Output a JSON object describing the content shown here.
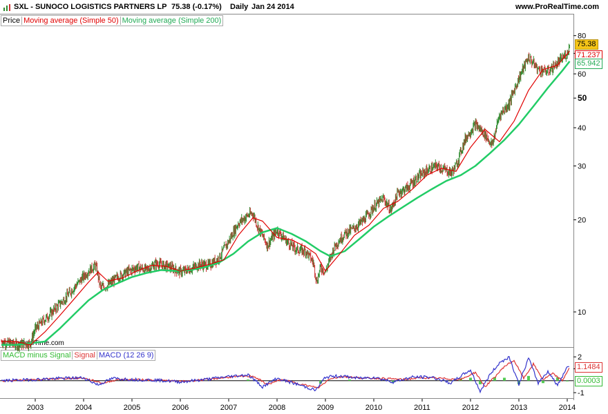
{
  "header": {
    "symbol_title": "SXL - SUNOCO LOGISTICS PARTNERS LP",
    "last_quote": "75.38 (-0.17%)",
    "interval": "Daily",
    "date": "Jan 24 2014",
    "website": "www.ProRealTime.com"
  },
  "main_legend": {
    "price": "Price",
    "ma50": "Moving average (Simple 50)",
    "ma200": "Moving average (Simple 200)"
  },
  "macd_legend": {
    "hist": "MACD minus Signal",
    "signal": "Signal",
    "macd": "MACD (12 26 9)"
  },
  "copyright": "© ProRealTime.com",
  "tags": {
    "price": "75.38",
    "ma50": "71.237",
    "ma200": "65.942",
    "signal": "1.1484",
    "hist": "0.0003"
  },
  "colors": {
    "up": "#2e8b2e",
    "down": "#cc3333",
    "ma50": "#e00000",
    "ma200": "#22cc66",
    "macd": "#3333cc",
    "signal": "#dd3333",
    "hist": "#55cc55",
    "price_tag_bg": "#f5c518"
  },
  "chart_data": [
    {
      "type": "line",
      "scale": "log",
      "ylim": [
        8,
        85
      ],
      "y_ticks": [
        80,
        70,
        60,
        50,
        40,
        30,
        20,
        10
      ],
      "x_ticks": [
        "2003",
        "2004",
        "2005",
        "2006",
        "2007",
        "2008",
        "2009",
        "2010",
        "2011",
        "2012",
        "2013",
        "2014"
      ],
      "x_range": [
        2002.3,
        2014.1
      ],
      "series": [
        {
          "name": "Price",
          "x": [
            2002.3,
            2002.6,
            2002.9,
            2003.0,
            2003.3,
            2003.6,
            2003.9,
            2004.1,
            2004.25,
            2004.35,
            2004.5,
            2004.7,
            2004.9,
            2005.1,
            2005.3,
            2005.5,
            2005.8,
            2006.0,
            2006.2,
            2006.4,
            2006.6,
            2006.8,
            2007.0,
            2007.2,
            2007.4,
            2007.5,
            2007.6,
            2007.8,
            2008.0,
            2008.2,
            2008.4,
            2008.6,
            2008.75,
            2008.82,
            2008.9,
            2009.0,
            2009.2,
            2009.4,
            2009.6,
            2009.8,
            2010.0,
            2010.2,
            2010.35,
            2010.5,
            2010.7,
            2010.9,
            2011.1,
            2011.3,
            2011.5,
            2011.6,
            2011.7,
            2011.9,
            2012.1,
            2012.3,
            2012.45,
            2012.6,
            2012.8,
            2013.0,
            2013.2,
            2013.4,
            2013.6,
            2013.8,
            2014.0,
            2014.05
          ],
          "values": [
            8.0,
            7.8,
            7.9,
            8.8,
            9.8,
            11.0,
            12.5,
            13.6,
            14.2,
            12.0,
            12.2,
            13.0,
            13.5,
            14.0,
            13.7,
            14.4,
            14.0,
            13.5,
            13.8,
            14.3,
            14.2,
            15.0,
            17.0,
            19.5,
            20.7,
            21.0,
            19.0,
            16.5,
            18.5,
            17.0,
            16.0,
            15.8,
            14.5,
            12.5,
            14.0,
            13.5,
            16.5,
            18.0,
            18.8,
            20.0,
            22.0,
            23.5,
            21.5,
            24.5,
            25.5,
            27.5,
            29.0,
            30.0,
            29.0,
            28.5,
            30.0,
            37.0,
            41.0,
            38.0,
            35.0,
            44.0,
            48.0,
            58.0,
            68.0,
            62.0,
            61.0,
            65.0,
            70.0,
            75.38
          ]
        },
        {
          "name": "Moving average (Simple 50)",
          "x": [
            2002.3,
            2002.6,
            2002.9,
            2003.2,
            2003.5,
            2003.8,
            2004.1,
            2004.3,
            2004.5,
            2004.8,
            2005.1,
            2005.4,
            2005.7,
            2006.0,
            2006.3,
            2006.6,
            2006.9,
            2007.2,
            2007.5,
            2007.7,
            2008.0,
            2008.3,
            2008.6,
            2008.8,
            2009.0,
            2009.3,
            2009.6,
            2009.9,
            2010.2,
            2010.5,
            2010.8,
            2011.1,
            2011.4,
            2011.7,
            2012.0,
            2012.3,
            2012.6,
            2012.9,
            2013.2,
            2013.5,
            2013.8,
            2014.05
          ],
          "values": [
            8.0,
            8.0,
            7.8,
            8.6,
            9.7,
            11.0,
            12.5,
            13.5,
            12.6,
            12.9,
            13.6,
            14.2,
            14.1,
            13.6,
            13.9,
            14.3,
            14.8,
            17.8,
            20.3,
            19.8,
            17.5,
            17.2,
            16.3,
            15.5,
            13.6,
            15.5,
            17.8,
            19.2,
            21.8,
            23.0,
            25.2,
            28.0,
            29.5,
            28.8,
            34.5,
            39.5,
            36.0,
            42.0,
            53.0,
            62.0,
            64.0,
            71.237
          ]
        },
        {
          "name": "Moving average (Simple 200)",
          "x": [
            2002.3,
            2002.6,
            2002.9,
            2003.2,
            2003.5,
            2003.8,
            2004.1,
            2004.4,
            2004.7,
            2005.0,
            2005.3,
            2005.6,
            2005.9,
            2006.2,
            2006.5,
            2006.8,
            2007.1,
            2007.4,
            2007.7,
            2008.0,
            2008.3,
            2008.6,
            2008.9,
            2009.1,
            2009.4,
            2009.7,
            2010.0,
            2010.3,
            2010.6,
            2010.9,
            2011.2,
            2011.5,
            2011.8,
            2012.1,
            2012.4,
            2012.7,
            2013.0,
            2013.3,
            2013.6,
            2013.9,
            2014.05
          ],
          "values": [
            7.8,
            7.8,
            7.9,
            8.0,
            8.8,
            9.8,
            10.9,
            11.8,
            12.4,
            13.0,
            13.4,
            13.7,
            13.6,
            13.7,
            14.0,
            14.5,
            15.5,
            17.0,
            18.2,
            18.8,
            18.0,
            17.0,
            15.8,
            15.2,
            15.8,
            17.3,
            19.0,
            20.5,
            22.0,
            23.6,
            25.2,
            26.8,
            28.0,
            30.0,
            33.0,
            36.5,
            41.0,
            47.0,
            54.0,
            61.5,
            65.942
          ]
        }
      ]
    },
    {
      "type": "line",
      "ylim": [
        -1.4,
        2.3
      ],
      "y_ticks": [
        2,
        1,
        -1
      ],
      "series": [
        {
          "name": "MACD (12 26 9)",
          "x": [
            2002.3,
            2003.0,
            2003.5,
            2004.0,
            2004.3,
            2004.6,
            2005.0,
            2005.5,
            2006.0,
            2006.5,
            2007.0,
            2007.4,
            2007.7,
            2008.0,
            2008.5,
            2008.8,
            2009.0,
            2009.3,
            2009.7,
            2010.0,
            2010.4,
            2010.8,
            2011.2,
            2011.6,
            2011.8,
            2012.0,
            2012.2,
            2012.4,
            2012.6,
            2012.8,
            2013.0,
            2013.2,
            2013.4,
            2013.6,
            2013.8,
            2014.0,
            2014.05
          ],
          "values": [
            0.0,
            0.1,
            0.2,
            0.25,
            -0.35,
            0.2,
            0.1,
            0.05,
            -0.1,
            0.1,
            0.35,
            0.5,
            -0.5,
            0.2,
            -0.4,
            -0.8,
            0.3,
            0.4,
            0.2,
            0.3,
            -0.1,
            0.3,
            0.3,
            -0.2,
            0.4,
            0.9,
            -0.9,
            0.5,
            1.5,
            2.0,
            -0.3,
            1.9,
            -0.2,
            0.8,
            -0.4,
            1.2,
            1.15
          ]
        },
        {
          "name": "Signal",
          "x": [
            2002.3,
            2003.0,
            2003.5,
            2004.0,
            2004.4,
            2004.7,
            2005.0,
            2005.5,
            2006.0,
            2006.5,
            2007.0,
            2007.5,
            2007.8,
            2008.1,
            2008.5,
            2008.85,
            2009.1,
            2009.4,
            2009.8,
            2010.2,
            2010.6,
            2011.0,
            2011.4,
            2011.8,
            2012.1,
            2012.3,
            2012.5,
            2012.7,
            2012.9,
            2013.1,
            2013.3,
            2013.5,
            2013.7,
            2013.9,
            2014.05
          ],
          "values": [
            0.0,
            0.08,
            0.18,
            0.22,
            -0.2,
            0.1,
            0.1,
            0.05,
            -0.05,
            0.08,
            0.3,
            0.4,
            -0.3,
            0.1,
            -0.3,
            -0.6,
            0.2,
            0.35,
            0.2,
            0.2,
            0.1,
            0.25,
            0.2,
            0.1,
            0.7,
            -0.5,
            0.3,
            1.2,
            1.7,
            0.2,
            1.4,
            0.1,
            0.6,
            0.0,
            1.1484
          ]
        },
        {
          "name": "MACD minus Signal",
          "x": [
            2007.4,
            2008.9,
            2009.5,
            2010.4,
            2011.8,
            2012.0,
            2012.2,
            2012.5,
            2012.7,
            2013.0,
            2013.2,
            2013.5,
            2013.8,
            2014.0
          ],
          "values": [
            0.1,
            -0.25,
            0.1,
            -0.15,
            0.2,
            0.25,
            -0.3,
            0.3,
            0.25,
            -0.3,
            0.4,
            -0.2,
            0.3,
            0.0003
          ]
        }
      ]
    }
  ]
}
